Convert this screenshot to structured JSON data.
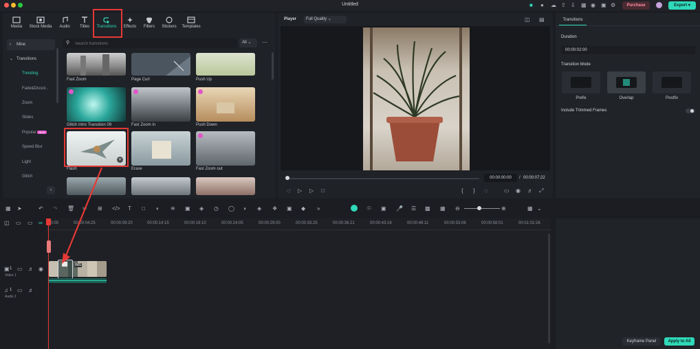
{
  "window": {
    "title": "Untitled"
  },
  "header": {
    "purchase_label": "Purchase",
    "export_label": "Export"
  },
  "toolbar": {
    "items": [
      {
        "label": "Media",
        "icon": "media-icon"
      },
      {
        "label": "Stock Media",
        "icon": "stock-media-icon"
      },
      {
        "label": "Audio",
        "icon": "music-note-icon"
      },
      {
        "label": "Titles",
        "icon": "text-t-icon"
      },
      {
        "label": "Transitions",
        "icon": "transition-arrow-icon"
      },
      {
        "label": "Effects",
        "icon": "sparkle-icon"
      },
      {
        "label": "Filters",
        "icon": "filters-icon"
      },
      {
        "label": "Stickers",
        "icon": "sticker-icon"
      },
      {
        "label": "Templates",
        "icon": "template-icon"
      }
    ]
  },
  "sidebar": {
    "mine": "Mine",
    "transitions": "Transitions",
    "items": [
      "Trending",
      "Fade&Dissol..",
      "Zoom",
      "Slides",
      "Popular",
      "Speed Blur",
      "Light",
      "Glitch"
    ],
    "popular_badge": "NEW"
  },
  "search": {
    "placeholder": "Search transitions",
    "filter": "All"
  },
  "thumbnails": [
    {
      "label": "Fast Zoom"
    },
    {
      "label": "Page Curl"
    },
    {
      "label": "Push Up"
    },
    {
      "label": "Glitch Intro Transition 09"
    },
    {
      "label": "Fast Zoom in"
    },
    {
      "label": "Push Down"
    },
    {
      "label": "Flash"
    },
    {
      "label": "Erase"
    },
    {
      "label": "Fast Zoom out"
    }
  ],
  "player": {
    "label": "Player",
    "quality": "Full Quality",
    "current_time": "00:00:00:00",
    "separator": "/",
    "total_time": "00:00:07:22",
    "progress": 0
  },
  "right_panel": {
    "tab": "Transitions",
    "duration_label": "Duration",
    "duration_value": "00:00:02:00",
    "mode_label": "Transition Mode",
    "modes": [
      "Prefix",
      "Overlap",
      "Postfix"
    ],
    "selected_mode": "Overlap",
    "trimmed_label": "Include Trimmed Frames",
    "trimmed_on": false,
    "keyframe_button": "Keyframe Panel",
    "apply_button": "Apply to All"
  },
  "timeline": {
    "ruler": [
      "00:00",
      "00:00:04:25",
      "00:00:09:20",
      "00:00:14:15",
      "00:00:19:10",
      "00:00:24:05",
      "00:00:29:00",
      "00:00:33:25",
      "00:00:38:21",
      "00:00:43:16",
      "00:00:48:11",
      "00:00:53:06",
      "00:00:58:01",
      "00:01:02:26"
    ],
    "video_track": {
      "index": "1",
      "label": "Video 1"
    },
    "audio_track": {
      "index": "1",
      "label": "Audio 1"
    },
    "clip_tag": "IMG"
  },
  "colors": {
    "accent": "#2fd9b9",
    "highlight": "#e53935",
    "purchase": "#ff8fa3"
  }
}
